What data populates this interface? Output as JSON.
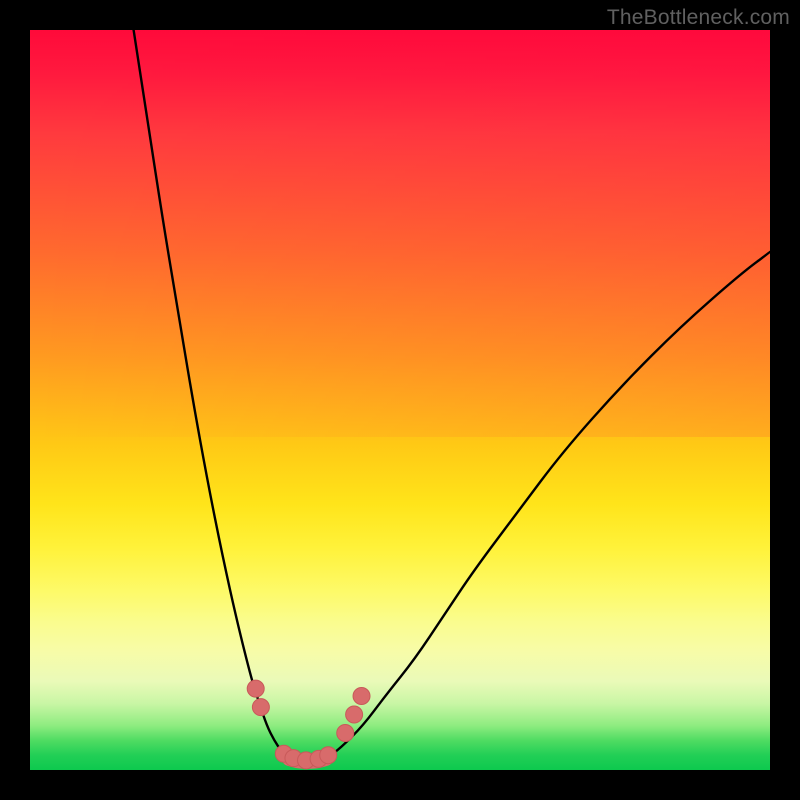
{
  "watermark": "TheBottleneck.com",
  "chart_data": {
    "type": "line",
    "title": "",
    "xlabel": "",
    "ylabel": "",
    "xlim": [
      0,
      100
    ],
    "ylim": [
      0,
      100
    ],
    "series": [
      {
        "name": "left-curve",
        "x": [
          14,
          16,
          18,
          20,
          22,
          24,
          26,
          28,
          30,
          31,
          32,
          33,
          34,
          35
        ],
        "y": [
          100,
          87,
          74,
          62,
          50,
          39,
          29,
          20,
          12,
          9,
          6,
          4,
          2.5,
          1.5
        ]
      },
      {
        "name": "right-curve",
        "x": [
          40,
          42,
          45,
          48,
          52,
          56,
          60,
          66,
          72,
          80,
          88,
          96,
          100
        ],
        "y": [
          1.5,
          3,
          6,
          10,
          15,
          21,
          27,
          35,
          43,
          52,
          60,
          67,
          70
        ]
      },
      {
        "name": "valley-floor",
        "x": [
          35,
          36,
          37,
          38,
          39,
          40
        ],
        "y": [
          1.5,
          1.2,
          1.1,
          1.1,
          1.2,
          1.5
        ]
      }
    ],
    "markers": [
      {
        "name": "left-marker-1",
        "x": 30.5,
        "y": 11.0
      },
      {
        "name": "left-marker-2",
        "x": 31.2,
        "y": 8.5
      },
      {
        "name": "floor-marker-1",
        "x": 34.3,
        "y": 2.2
      },
      {
        "name": "floor-marker-2",
        "x": 35.6,
        "y": 1.6
      },
      {
        "name": "floor-marker-3",
        "x": 37.3,
        "y": 1.3
      },
      {
        "name": "floor-marker-4",
        "x": 39.0,
        "y": 1.5
      },
      {
        "name": "floor-marker-5",
        "x": 40.3,
        "y": 2.0
      },
      {
        "name": "right-marker-1",
        "x": 42.6,
        "y": 5.0
      },
      {
        "name": "right-marker-2",
        "x": 43.8,
        "y": 7.5
      },
      {
        "name": "right-marker-3",
        "x": 44.8,
        "y": 10.0
      }
    ],
    "colors": {
      "curve": "#000000",
      "marker_fill": "#d86b6b",
      "marker_stroke": "#c85a5a",
      "valley_stroke": "#d86b6b"
    }
  }
}
